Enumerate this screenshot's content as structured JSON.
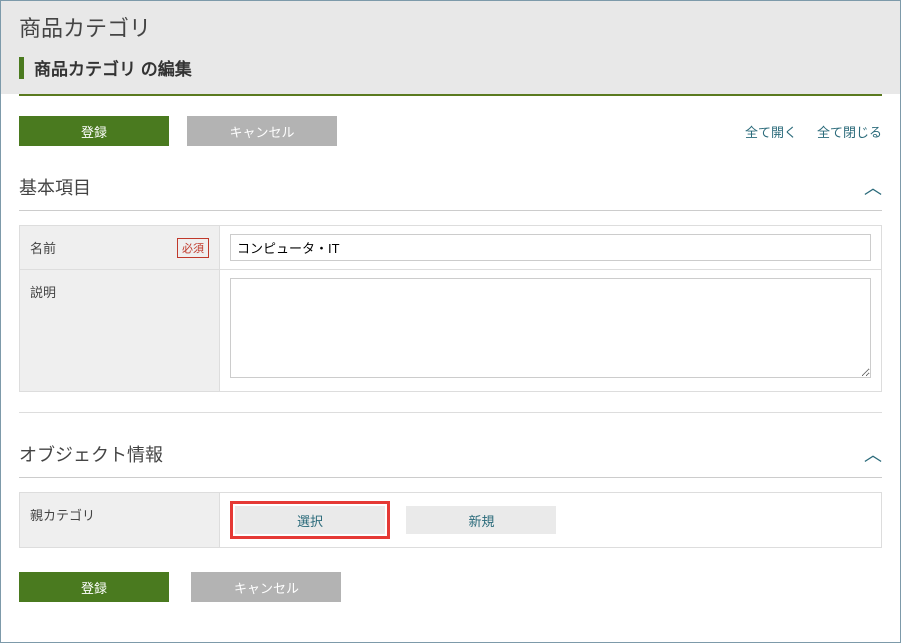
{
  "header": {
    "page_title": "商品カテゴリ",
    "sub_title": "商品カテゴリ の編集"
  },
  "actions": {
    "register": "登録",
    "cancel": "キャンセル",
    "expand_all": "全て開く",
    "collapse_all": "全て閉じる"
  },
  "sections": {
    "basic": {
      "title": "基本項目",
      "name_label": "名前",
      "required_badge": "必須",
      "name_value": "コンピュータ・IT",
      "desc_label": "説明",
      "desc_value": ""
    },
    "object": {
      "title": "オブジェクト情報",
      "parent_label": "親カテゴリ",
      "select_btn": "選択",
      "new_btn": "新規"
    }
  }
}
